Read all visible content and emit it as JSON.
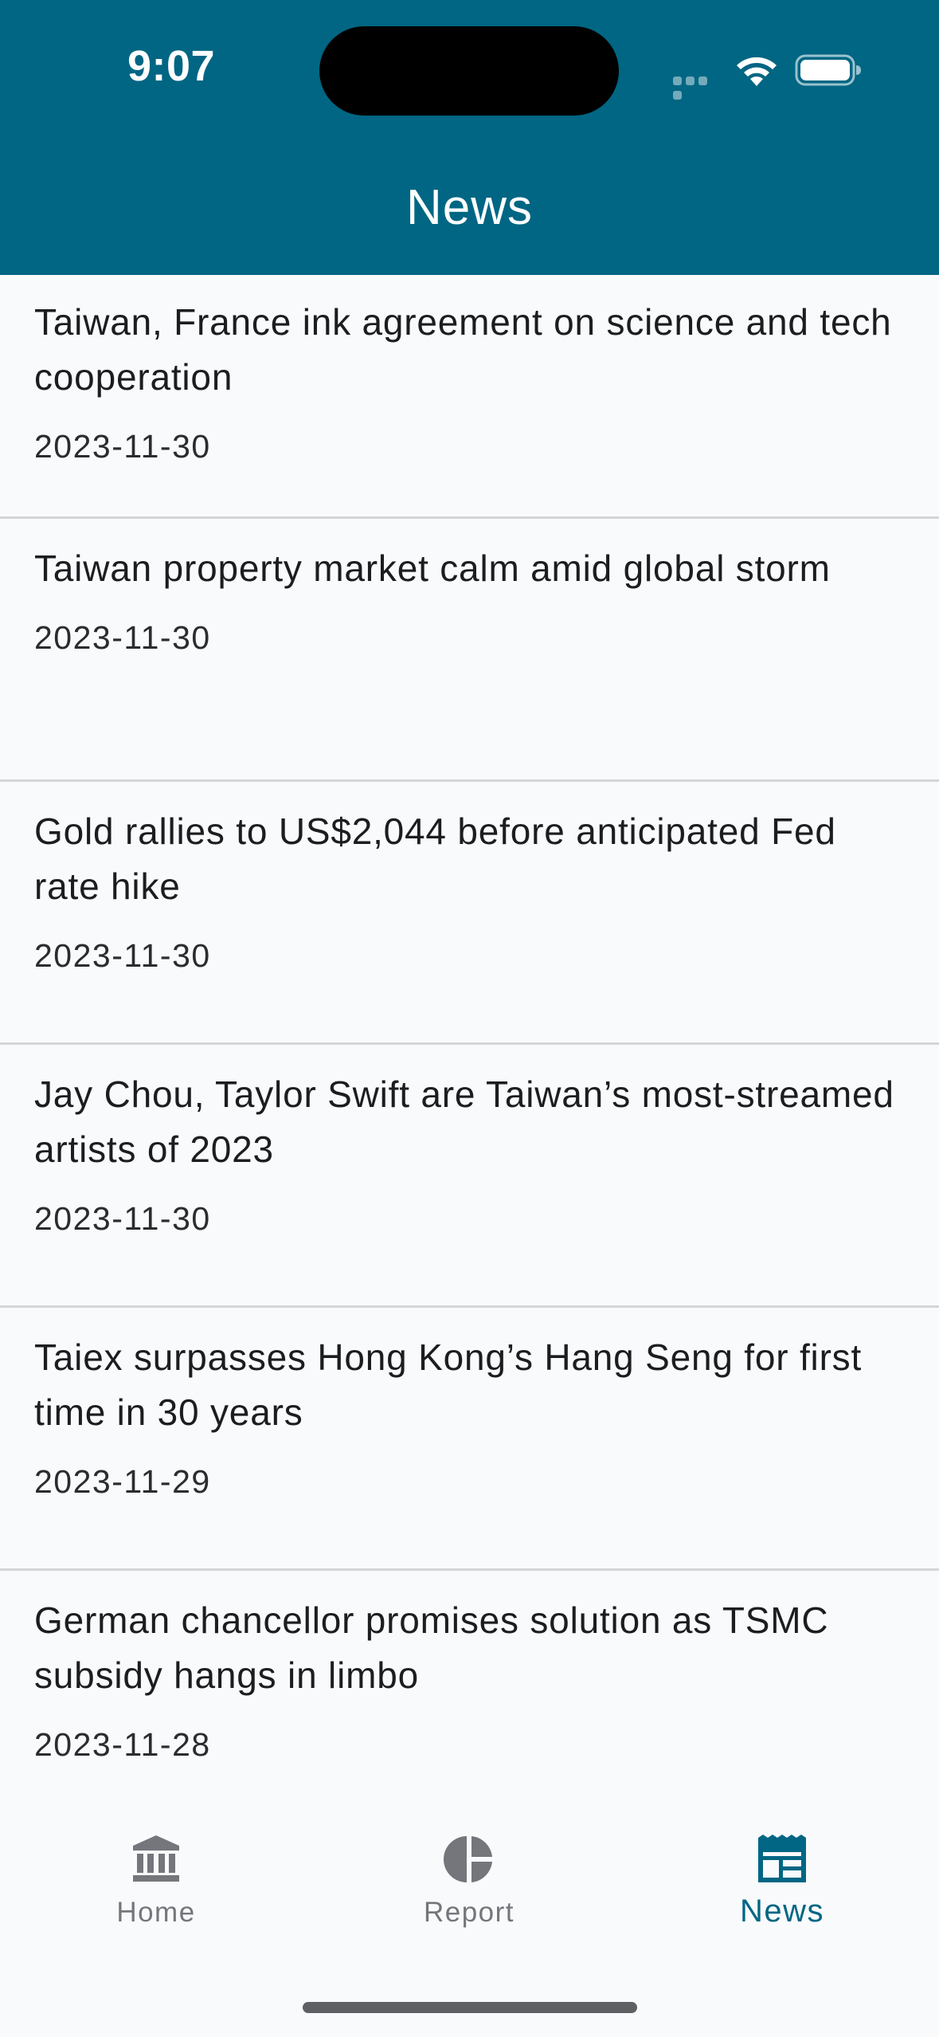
{
  "status_bar": {
    "time": "9:07"
  },
  "header": {
    "title": "News"
  },
  "news": [
    {
      "title": "Taiwan, France ink agreement on science and tech cooperation",
      "date": "2023-11-30"
    },
    {
      "title": "Taiwan property market calm amid global storm",
      "date": "2023-11-30"
    },
    {
      "title": "Gold rallies to US$2,044 before anticipated Fed rate hike",
      "date": "2023-11-30"
    },
    {
      "title": "Jay Chou, Taylor Swift are Taiwan’s most-streamed artists of 2023",
      "date": "2023-11-30"
    },
    {
      "title": "Taiex surpasses Hong Kong’s Hang Seng for first time in 30 years",
      "date": "2023-11-29"
    },
    {
      "title": "German chancellor promises solution as TSMC subsidy hangs in limbo",
      "date": "2023-11-28"
    }
  ],
  "tab_bar": {
    "items": [
      {
        "label": "Home",
        "icon": "bank-icon",
        "active": false
      },
      {
        "label": "Report",
        "icon": "pie-chart-icon",
        "active": false
      },
      {
        "label": "News",
        "icon": "newspaper-icon",
        "active": true
      }
    ]
  },
  "colors": {
    "header_bg": "#006683",
    "accent": "#006683",
    "inactive_tab": "#74767b",
    "background": "#f9fafc"
  }
}
